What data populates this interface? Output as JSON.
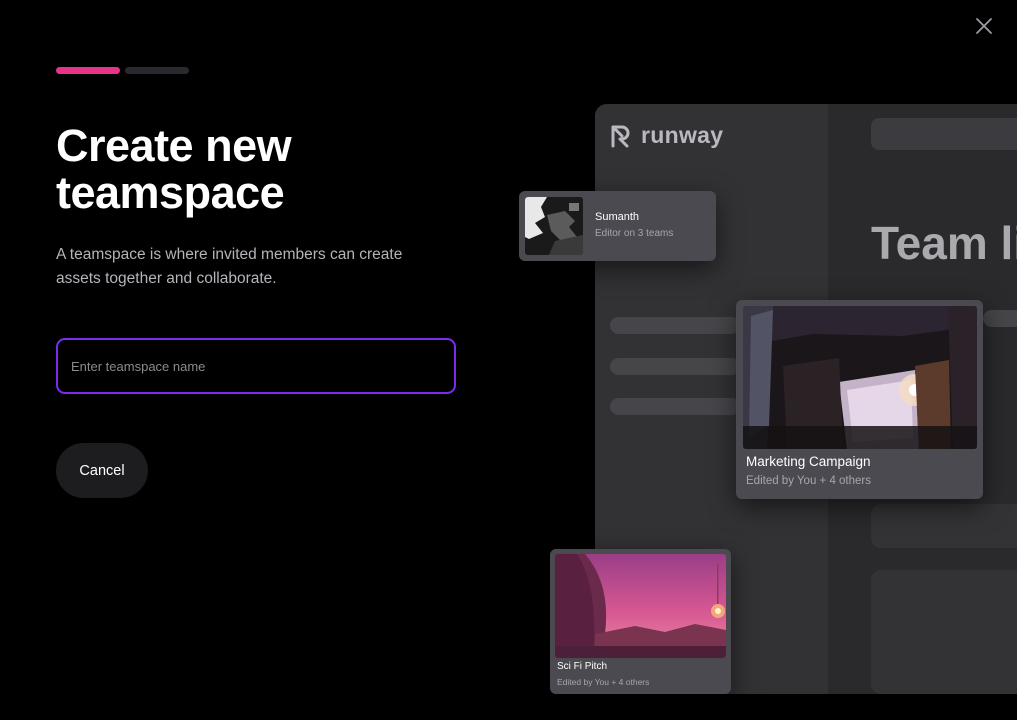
{
  "modal": {
    "progress_steps": 2,
    "progress_current": 1,
    "title": "Create new teamspace",
    "description": "A teamspace is where invited members can create assets together and collaborate.",
    "name_input": {
      "value": "",
      "placeholder": "Enter teamspace name"
    },
    "cancel_label": "Cancel",
    "close_icon": "close-icon"
  },
  "illustration": {
    "logo_text": "runway",
    "heading": "Team li",
    "user_card": {
      "name": "Sumanth",
      "role": "Editor on 3 teams"
    },
    "project_cards": [
      {
        "title": "Marketing Campaign",
        "subtitle": "Edited by You + 4 others"
      },
      {
        "title": "Sci Fi Pitch",
        "subtitle": "Edited by You + 4 others"
      }
    ]
  },
  "colors": {
    "background": "#000000",
    "accent_progress": "#e6348b",
    "input_border": "#7a2cf0",
    "button_bg": "#1d1d20"
  }
}
